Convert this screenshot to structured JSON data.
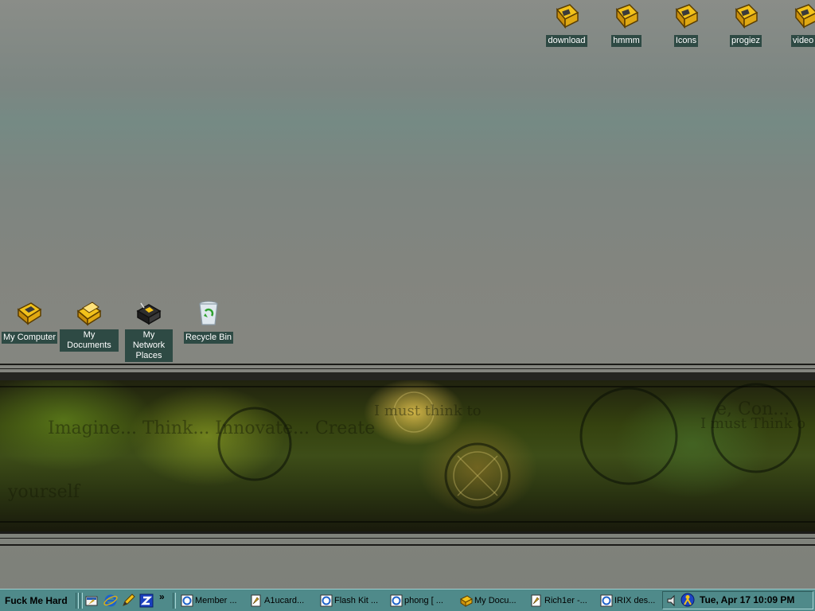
{
  "desktop": {
    "top_icons": [
      {
        "label": "download"
      },
      {
        "label": "hmmm"
      },
      {
        "label": "Icons"
      },
      {
        "label": "progiez"
      },
      {
        "label": "video"
      }
    ],
    "system_icons": [
      {
        "label": "My Computer",
        "icon": "my-computer-icon"
      },
      {
        "label": "My Documents",
        "icon": "my-documents-icon"
      },
      {
        "label": "My Network Places",
        "icon": "network-places-icon"
      },
      {
        "label": "Recycle Bin",
        "icon": "recycle-bin-icon"
      }
    ],
    "wallpaper_text": [
      "Imagine... Think... Innovate... Create",
      "I must think to",
      "e, Con...",
      "I must Think o",
      "yourself"
    ]
  },
  "taskbar": {
    "start_label": "Fuck Me Hard",
    "quick_launch": [
      "show-desktop-icon",
      "internet-explorer-icon",
      "pencil-icon",
      "zone-icon"
    ],
    "more_label": "»",
    "tasks": [
      {
        "label": "Member ...",
        "icon": "internet-explorer-icon"
      },
      {
        "label": "A1ucard...",
        "icon": "document-icon"
      },
      {
        "label": "Flash Kit ...",
        "icon": "internet-explorer-icon"
      },
      {
        "label": "phong [ ...",
        "icon": "internet-explorer-icon"
      },
      {
        "label": "My Docu...",
        "icon": "folder-icon"
      },
      {
        "label": "Rich1er -...",
        "icon": "document-icon"
      },
      {
        "label": "IRIX des...",
        "icon": "internet-explorer-icon"
      }
    ],
    "tray": {
      "icons": [
        "volume-icon",
        "messenger-icon"
      ],
      "clock": "Tue, Apr 17 10:09 PM"
    }
  },
  "colors": {
    "taskbar": "#4f8a8a",
    "icon_label_bg": "#2e4a44",
    "folder_yellow": "#f2c21b"
  }
}
